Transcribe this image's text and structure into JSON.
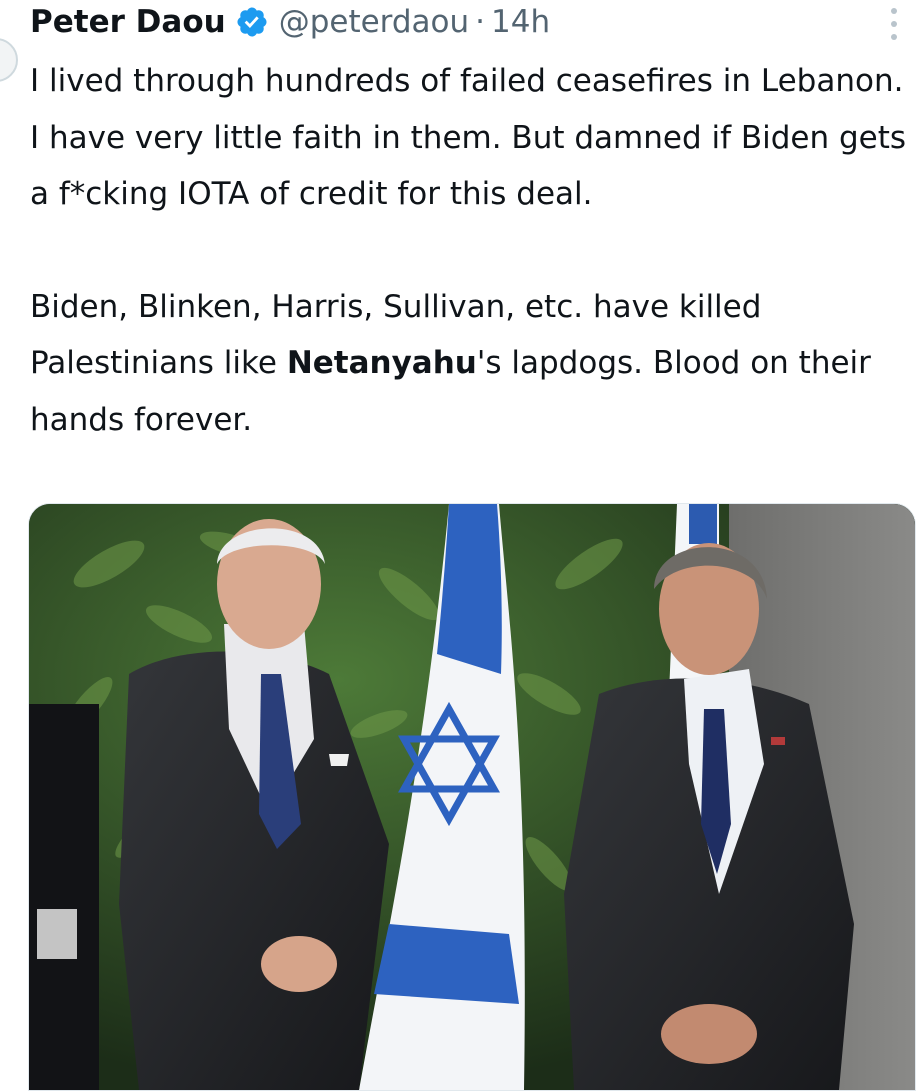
{
  "tweet": {
    "author_name": "Peter Daou",
    "handle": "@peterdaou",
    "separator": "·",
    "time": "14h",
    "verified_icon": "verified-badge-icon",
    "more_icon": "more-options-icon",
    "paragraph1": "I lived through hundreds of failed ceasefires in Lebanon. I have very little faith in them. But damned if Biden gets a f*cking IOTA of credit for this deal.",
    "p2_before": "Biden, Blinken, Harris, Sullivan, etc. have killed Palestinians like ",
    "p2_bold": "Netanyahu",
    "p2_after": "'s lapdogs. Blood on their hands forever.",
    "accent_color": "#1d9bf0"
  },
  "media": {
    "description_icon": "photo-attachment"
  }
}
